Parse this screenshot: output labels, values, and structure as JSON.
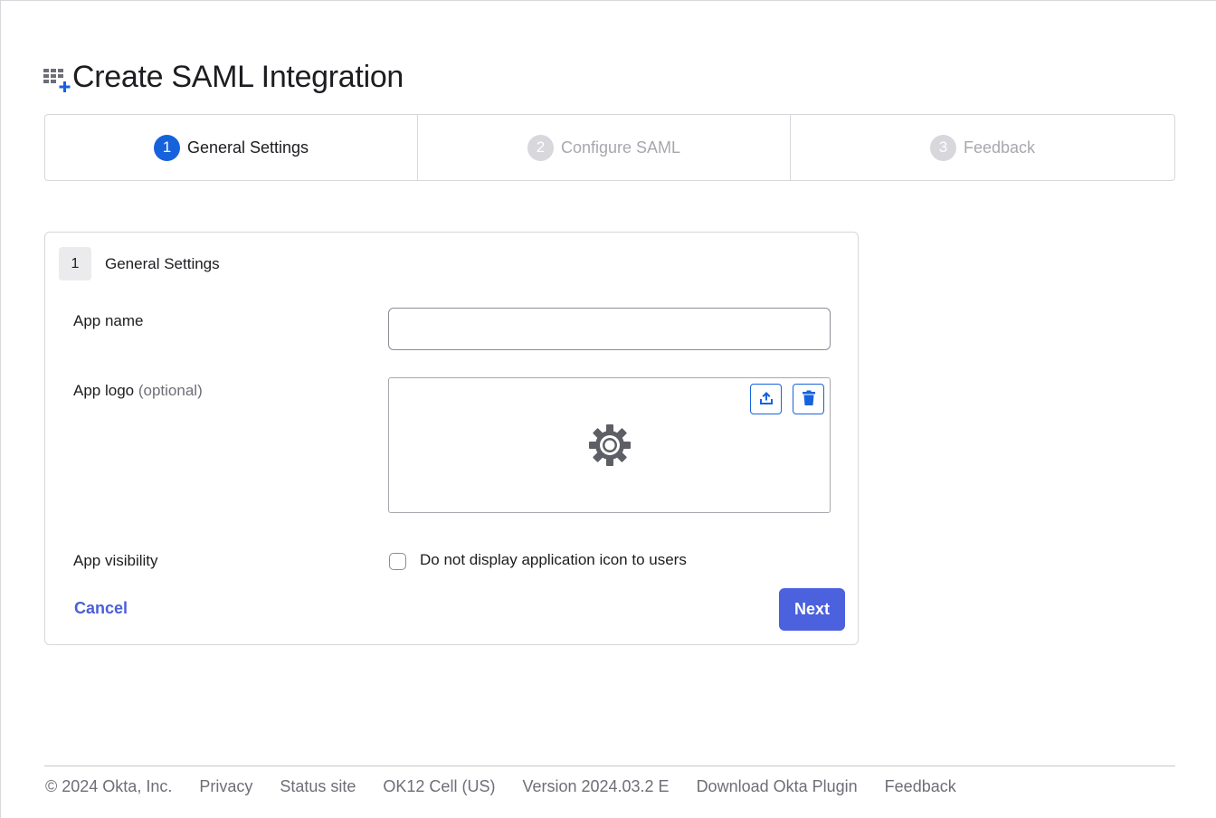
{
  "header": {
    "title": "Create SAML Integration",
    "icon": "app-add-icon"
  },
  "wizard": {
    "steps": [
      {
        "number": "1",
        "label": "General Settings",
        "state": "active"
      },
      {
        "number": "2",
        "label": "Configure SAML",
        "state": "inactive"
      },
      {
        "number": "3",
        "label": "Feedback",
        "state": "inactive"
      }
    ]
  },
  "panel": {
    "step_number": "1",
    "title": "General Settings",
    "app_name": {
      "label": "App name",
      "value": "",
      "placeholder": ""
    },
    "app_logo": {
      "label": "App logo",
      "optional": "(optional)",
      "icons": [
        "upload-icon",
        "trash-icon",
        "gear-icon"
      ]
    },
    "app_visibility": {
      "label": "App visibility",
      "checkbox_label": "Do not display application icon to users",
      "checked": false
    },
    "cancel_label": "Cancel",
    "next_label": "Next"
  },
  "footer": {
    "copyright": "© 2024 Okta, Inc.",
    "links": [
      "Privacy",
      "Status site",
      "OK12 Cell (US)",
      "Version 2024.03.2 E",
      "Download Okta Plugin",
      "Feedback"
    ]
  },
  "colors": {
    "accent_blue": "#1662dd",
    "button_blue": "#4b61dd",
    "link_blue": "#4b5fd9",
    "inactive_gray": "#d7d7dc"
  }
}
